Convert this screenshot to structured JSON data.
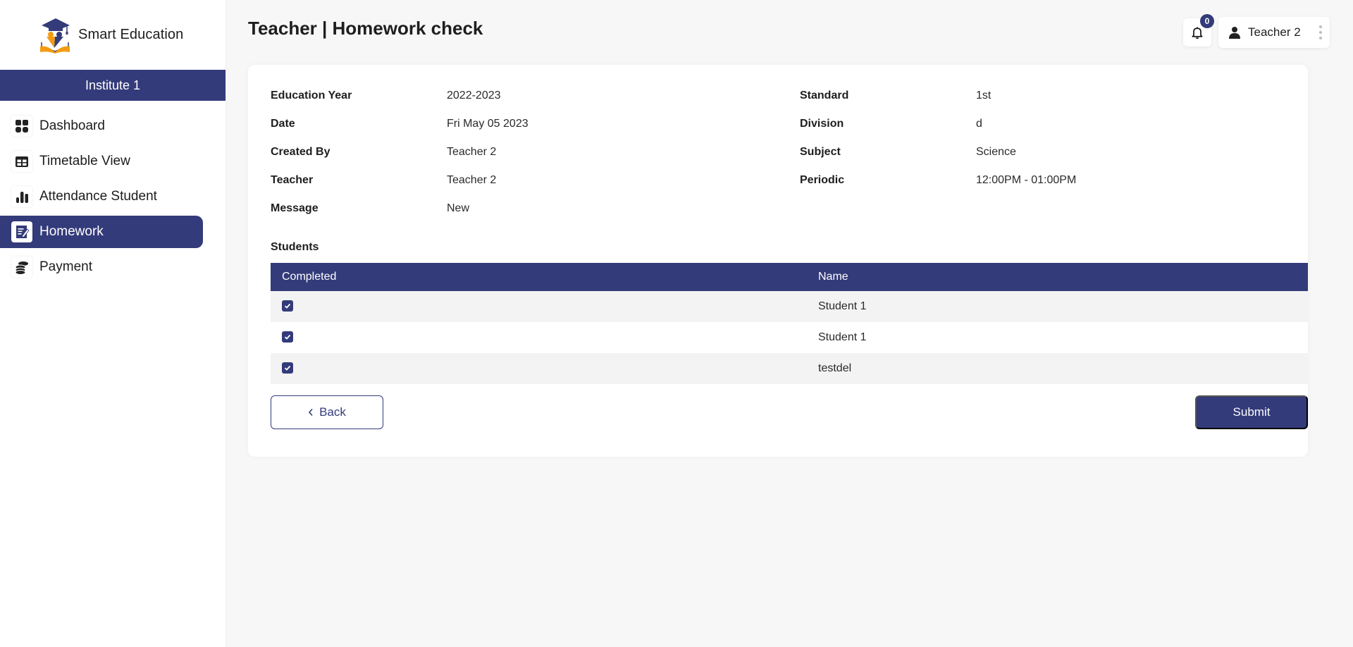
{
  "brand": {
    "name": "Smart Education",
    "logo_icon": "graduation-logo-icon"
  },
  "institute": "Institute 1",
  "sidebar": {
    "items": [
      {
        "label": "Dashboard",
        "icon": "dashboard-grid-icon",
        "active": false
      },
      {
        "label": "Timetable View",
        "icon": "table-icon",
        "active": false
      },
      {
        "label": "Attendance Student",
        "icon": "bar-chart-icon",
        "active": false
      },
      {
        "label": "Homework",
        "icon": "homework-edit-icon",
        "active": true
      },
      {
        "label": "Payment",
        "icon": "coins-icon",
        "active": false
      }
    ]
  },
  "header": {
    "title": "Teacher | Homework check",
    "notifications_count": "0",
    "user_name": "Teacher 2"
  },
  "details": {
    "left": [
      {
        "label": "Education Year",
        "value": "2022-2023"
      },
      {
        "label": "Date",
        "value": "Fri May 05 2023"
      },
      {
        "label": "Created By",
        "value": "Teacher 2"
      },
      {
        "label": "Teacher",
        "value": "Teacher 2"
      },
      {
        "label": "Message",
        "value": "New"
      }
    ],
    "right": [
      {
        "label": "Standard",
        "value": "1st"
      },
      {
        "label": "Division",
        "value": "d"
      },
      {
        "label": "Subject",
        "value": "Science"
      },
      {
        "label": "Periodic",
        "value": "12:00PM - 01:00PM"
      }
    ]
  },
  "students": {
    "title": "Students",
    "columns": [
      "Completed",
      "Name"
    ],
    "rows": [
      {
        "completed": true,
        "name": "Student 1"
      },
      {
        "completed": true,
        "name": "Student 1"
      },
      {
        "completed": true,
        "name": "testdel"
      }
    ]
  },
  "actions": {
    "back_label": "Back",
    "submit_label": "Submit"
  },
  "colors": {
    "primary": "#343b7a",
    "background": "#f7f7f7",
    "row_alt": "#f3f3f3"
  }
}
